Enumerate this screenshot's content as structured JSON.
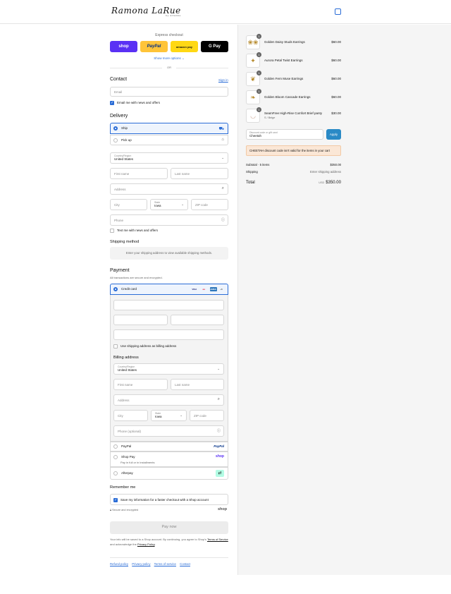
{
  "brand": {
    "name": "Ramona LaRue",
    "sub": "by Arianne"
  },
  "express": {
    "title": "Express checkout",
    "buttons": [
      {
        "label": "shop",
        "bg": "#5a31f4",
        "fg": "#ffffff"
      },
      {
        "label": "PayPal",
        "bg": "#ffc439",
        "fg": "#003087"
      },
      {
        "label": "amazon pay",
        "bg": "#ffd814",
        "fg": "#111111"
      },
      {
        "label": "G Pay",
        "bg": "#000000",
        "fg": "#ffffff"
      }
    ],
    "more": "Show more options ⌄",
    "or": "OR"
  },
  "contact": {
    "heading": "Contact",
    "sign_in": "Sign in",
    "email_placeholder": "Email",
    "news_label": "Email me with news and offers"
  },
  "delivery": {
    "heading": "Delivery",
    "ship": "Ship",
    "pickup": "Pick up",
    "country_label": "Country/Region",
    "country_value": "United States",
    "first": "First name",
    "last": "Last name",
    "address": "Address",
    "city": "City",
    "state_label": "State",
    "state_value": "Iowa",
    "zip": "ZIP code",
    "phone": "Phone",
    "text_me": "Text me with news and offers"
  },
  "shipping": {
    "heading": "Shipping method",
    "note": "Enter your shipping address to view available shipping methods."
  },
  "payment": {
    "heading": "Payment",
    "sub": "All transactions are secure and encrypted.",
    "credit": "Credit card",
    "more_cards": "+6",
    "use_shipping": "Use shipping address as billing address",
    "billing_heading": "Billing address",
    "country_label": "Country/Region",
    "country_value": "United States",
    "first": "First name",
    "last": "Last name",
    "address": "Address",
    "city": "City",
    "state_label": "State",
    "state_value": "Iowa",
    "zip": "ZIP code",
    "phone": "Phone (optional)",
    "paypal": "PayPal",
    "paypal_logo": "PayPal",
    "shoppay": "Shop Pay",
    "shoppay_sub": "Pay in full or in installments",
    "shoppay_logo": "shop",
    "afterpay": "Afterpay"
  },
  "remember": {
    "heading": "Remember me",
    "save": "Save my information for a faster checkout with a Shop account",
    "secure": "Secure and encrypted",
    "shop_logo": "shop"
  },
  "pay_now": "Pay now",
  "legal": {
    "line1": "Your info will be saved to a Shop account. By continuing, you agree to Shop's",
    "terms": "Terms of Service",
    "mid": "and acknowledge the",
    "privacy": "Privacy Policy",
    "end": "."
  },
  "footer_links": [
    "Refund policy",
    "Privacy policy",
    "Terms of service",
    "Contact"
  ],
  "cart": {
    "items": [
      {
        "name": "Golden Daisy Studs Earrings",
        "variant": "",
        "price": "$60.00",
        "qty": "1",
        "icon": "❀❀"
      },
      {
        "name": "Aurora Petal Twist Earrings",
        "variant": "",
        "price": "$60.00",
        "qty": "1",
        "icon": "✦"
      },
      {
        "name": "Golden Fern Muse Earrings",
        "variant": "",
        "price": "$60.00",
        "qty": "1",
        "icon": "❦"
      },
      {
        "name": "Golden Bloom Cascade Earrings",
        "variant": "",
        "price": "$60.00",
        "qty": "1",
        "icon": "❧"
      },
      {
        "name": "SeamFree High-Rise Comfort Brief panty",
        "variant": "S / Beige",
        "price": "$30.00",
        "qty": "1",
        "icon": "◡"
      }
    ],
    "discount_label": "Discount code or gift card",
    "discount_value": "Cheetah",
    "apply": "Apply",
    "error": "CHEETAH discount code isn't valid for the items in your cart",
    "subtotal_label": "Subtotal · 5 items",
    "subtotal": "$350.00",
    "shipping_label": "Shipping",
    "shipping_value": "Enter shipping address",
    "total_label": "Total",
    "currency": "USD",
    "total": "$350.00"
  }
}
